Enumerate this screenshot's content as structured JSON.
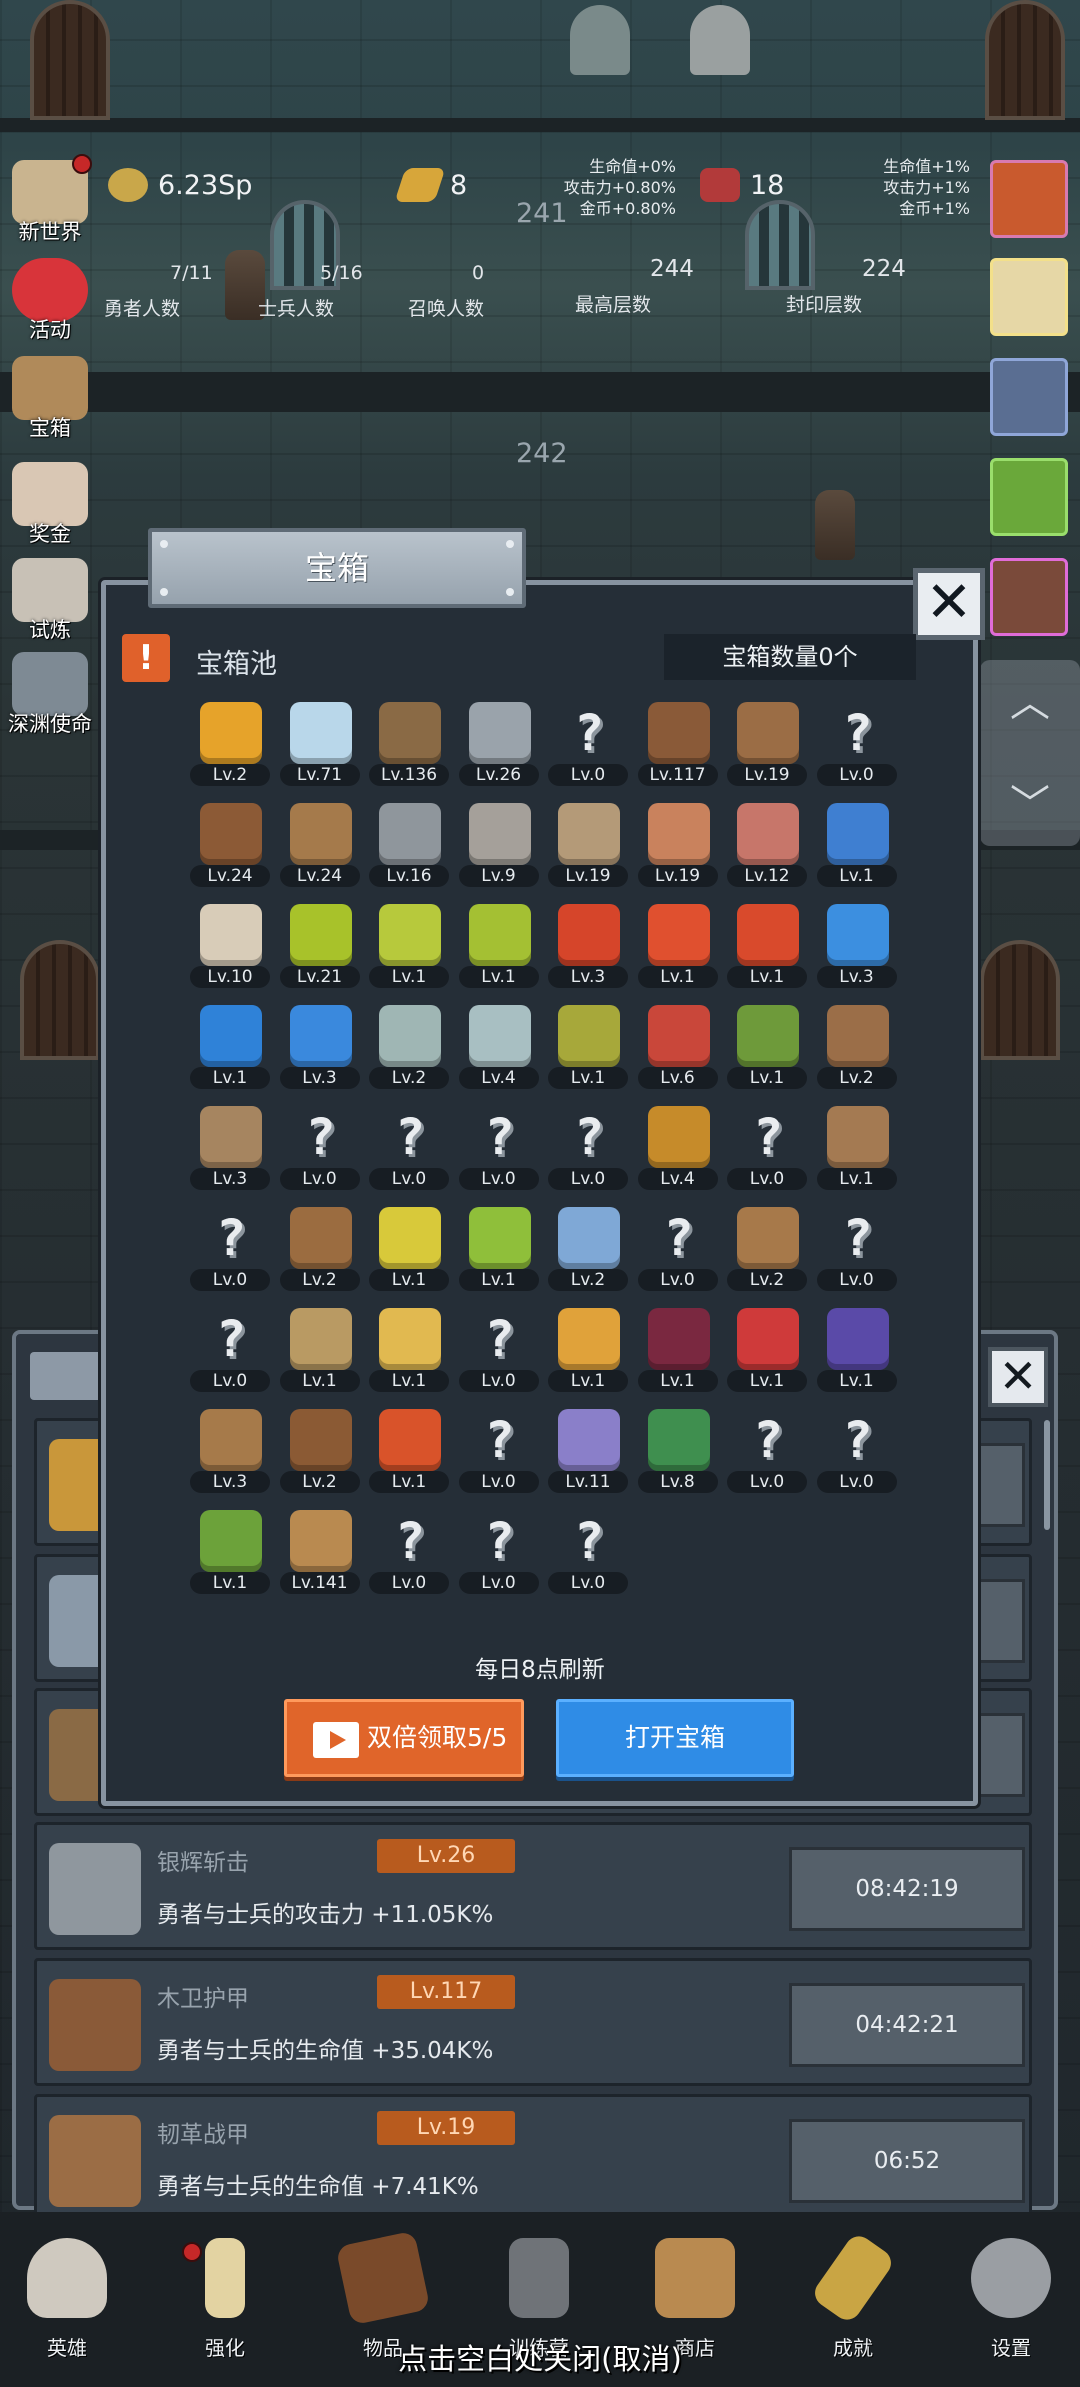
{
  "background": {
    "floor_number_top": "241",
    "floor_number_mid": "242"
  },
  "hud": {
    "coins": "6.23Sp",
    "gold_bars": "8",
    "meat": "18",
    "buff_left": [
      "生命值+0%",
      "攻击力+0.80%",
      "金币+0.80%"
    ],
    "buff_right": [
      "生命值+1%",
      "攻击力+1%",
      "金币+1%"
    ],
    "counts": [
      {
        "value": "7/11",
        "label": "勇者人数"
      },
      {
        "value": "5/16",
        "label": "士兵人数"
      },
      {
        "value": "0",
        "label": "召唤人数"
      },
      {
        "value": "244",
        "label": "最高层数"
      },
      {
        "value": "224",
        "label": "封印层数"
      }
    ]
  },
  "left_menu": [
    {
      "label": "新世界",
      "icon": "scroll-map-icon",
      "color": "#c9b48f",
      "dot": true
    },
    {
      "label": "活动",
      "icon": "heart-icon",
      "color": "#d8343a",
      "dot": false
    },
    {
      "label": "宝箱",
      "icon": "chest-icon",
      "color": "#b08a5a",
      "dot": false
    },
    {
      "label": "奖金",
      "icon": "envelope-icon",
      "color": "#d9c7b4",
      "dot": false
    },
    {
      "label": "试炼",
      "icon": "feather-icon",
      "color": "#c8c1b6",
      "dot": false
    },
    {
      "label": "深渊使命",
      "icon": "abyss-icon",
      "color": "#7e8a94",
      "dot": false
    }
  ],
  "dialog": {
    "title": "宝箱",
    "pool_title": "宝箱池",
    "chest_count": "宝箱数量0个",
    "refresh_note": "每日8点刷新",
    "double_claim": "双倍领取5/5",
    "open_chest": "打开宝箱"
  },
  "items": [
    {
      "icon": "crown-icon",
      "lv": "Lv.2",
      "color": "#e6a32a"
    },
    {
      "icon": "diamond-icon",
      "lv": "Lv.71",
      "color": "#b9d7ea"
    },
    {
      "icon": "sword-icon",
      "lv": "Lv.136",
      "color": "#8a6a45"
    },
    {
      "icon": "sword-icon",
      "lv": "Lv.26",
      "color": "#9aa3ab"
    },
    {
      "icon": "unknown-icon",
      "lv": "Lv.0",
      "color": ""
    },
    {
      "icon": "armor-icon",
      "lv": "Lv.117",
      "color": "#8a5a38"
    },
    {
      "icon": "leather-armor-icon",
      "lv": "Lv.19",
      "color": "#9b6d45"
    },
    {
      "icon": "unknown-icon",
      "lv": "Lv.0",
      "color": ""
    },
    {
      "icon": "leather-helmet-icon",
      "lv": "Lv.24",
      "color": "#8c5a36"
    },
    {
      "icon": "dagger-icon",
      "lv": "Lv.24",
      "color": "#a57a4b"
    },
    {
      "icon": "knight-helmet-icon",
      "lv": "Lv.16",
      "color": "#8f969c"
    },
    {
      "icon": "hammer-icon",
      "lv": "Lv.9",
      "color": "#a5a09a"
    },
    {
      "icon": "great-helm-icon",
      "lv": "Lv.19",
      "color": "#b49a78"
    },
    {
      "icon": "ham-icon",
      "lv": "Lv.19",
      "color": "#c9825d"
    },
    {
      "icon": "steak-icon",
      "lv": "Lv.12",
      "color": "#c7766a"
    },
    {
      "icon": "blue-sack-icon",
      "lv": "Lv.1",
      "color": "#3f7fd1"
    },
    {
      "icon": "flour-icon",
      "lv": "Lv.10",
      "color": "#d8ccb8"
    },
    {
      "icon": "green-potion-icon",
      "lv": "Lv.21",
      "color": "#a8c22a"
    },
    {
      "icon": "green-potion-icon",
      "lv": "Lv.1",
      "color": "#b7c93c"
    },
    {
      "icon": "green-potion-icon",
      "lv": "Lv.1",
      "color": "#a4c033"
    },
    {
      "icon": "red-potion-icon",
      "lv": "Lv.3",
      "color": "#d6452a"
    },
    {
      "icon": "red-potion-icon",
      "lv": "Lv.1",
      "color": "#e0502f"
    },
    {
      "icon": "red-potion-icon",
      "lv": "Lv.1",
      "color": "#d94a2c"
    },
    {
      "icon": "blue-potion-icon",
      "lv": "Lv.3",
      "color": "#3c8fe0"
    },
    {
      "icon": "blue-potion-icon",
      "lv": "Lv.1",
      "color": "#2f82d8"
    },
    {
      "icon": "blue-potion-icon",
      "lv": "Lv.3",
      "color": "#3a89dd"
    },
    {
      "icon": "vial-icon",
      "lv": "Lv.2",
      "color": "#9fb6b4"
    },
    {
      "icon": "vial-icon",
      "lv": "Lv.4",
      "color": "#a8bfc2"
    },
    {
      "icon": "yellow-bottle-icon",
      "lv": "Lv.1",
      "color": "#a7a83a"
    },
    {
      "icon": "red-bottle-icon",
      "lv": "Lv.6",
      "color": "#c9473a"
    },
    {
      "icon": "winged-boot-icon",
      "lv": "Lv.1",
      "color": "#6e9a3a"
    },
    {
      "icon": "boot-icon",
      "lv": "Lv.2",
      "color": "#9b6e48"
    },
    {
      "icon": "shoe-icon",
      "lv": "Lv.3",
      "color": "#a68560"
    },
    {
      "icon": "unknown-icon",
      "lv": "Lv.0",
      "color": ""
    },
    {
      "icon": "unknown-icon",
      "lv": "Lv.0",
      "color": ""
    },
    {
      "icon": "unknown-icon",
      "lv": "Lv.0",
      "color": ""
    },
    {
      "icon": "unknown-icon",
      "lv": "Lv.0",
      "color": ""
    },
    {
      "icon": "torch-icon",
      "lv": "Lv.4",
      "color": "#c68b2a"
    },
    {
      "icon": "unknown-icon",
      "lv": "Lv.0",
      "color": ""
    },
    {
      "icon": "mushroom-icon",
      "lv": "Lv.1",
      "color": "#a47a52"
    },
    {
      "icon": "unknown-icon",
      "lv": "Lv.0",
      "color": ""
    },
    {
      "icon": "staff-icon",
      "lv": "Lv.2",
      "color": "#9b6c40"
    },
    {
      "icon": "lemon-icon",
      "lv": "Lv.1",
      "color": "#d8c93a"
    },
    {
      "icon": "lime-icon",
      "lv": "Lv.1",
      "color": "#8fbf3a"
    },
    {
      "icon": "scepter-icon",
      "lv": "Lv.2",
      "color": "#7fa8d6"
    },
    {
      "icon": "unknown-icon",
      "lv": "Lv.0",
      "color": ""
    },
    {
      "icon": "backpack-icon",
      "lv": "Lv.2",
      "color": "#a7794a"
    },
    {
      "icon": "unknown-icon",
      "lv": "Lv.0",
      "color": ""
    },
    {
      "icon": "unknown-icon",
      "lv": "Lv.0",
      "color": ""
    },
    {
      "icon": "spiked-club-icon",
      "lv": "Lv.1",
      "color": "#b99a63"
    },
    {
      "icon": "cheese-icon",
      "lv": "Lv.1",
      "color": "#e1b950"
    },
    {
      "icon": "unknown-icon",
      "lv": "Lv.0",
      "color": ""
    },
    {
      "icon": "honey-jar-icon",
      "lv": "Lv.1",
      "color": "#e0a23a"
    },
    {
      "icon": "crystal-icon",
      "lv": "Lv.1",
      "color": "#7a2840"
    },
    {
      "icon": "red-orb-icon",
      "lv": "Lv.1",
      "color": "#cf3a3a"
    },
    {
      "icon": "magic-cube-icon",
      "lv": "Lv.1",
      "color": "#5a4aa8"
    },
    {
      "icon": "bow-icon",
      "lv": "Lv.3",
      "color": "#a67a4a"
    },
    {
      "icon": "quiver-icon",
      "lv": "Lv.2",
      "color": "#8b5a34"
    },
    {
      "icon": "flame-gauntlet-icon",
      "lv": "Lv.1",
      "color": "#d9532a"
    },
    {
      "icon": "unknown-icon",
      "lv": "Lv.0",
      "color": ""
    },
    {
      "icon": "rune-frame-icon",
      "lv": "Lv.11",
      "color": "#8a7fc9"
    },
    {
      "icon": "emblem-icon",
      "lv": "Lv.8",
      "color": "#3f8f4f"
    },
    {
      "icon": "unknown-icon",
      "lv": "Lv.0",
      "color": ""
    },
    {
      "icon": "unknown-icon",
      "lv": "Lv.0",
      "color": ""
    },
    {
      "icon": "green-wand-icon",
      "lv": "Lv.1",
      "color": "#6ca23a"
    },
    {
      "icon": "beer-mug-icon",
      "lv": "Lv.141",
      "color": "#b98a50"
    },
    {
      "icon": "unknown-icon",
      "lv": "Lv.0",
      "color": ""
    },
    {
      "icon": "unknown-icon",
      "lv": "Lv.0",
      "color": ""
    },
    {
      "icon": "unknown-icon",
      "lv": "Lv.0",
      "color": ""
    }
  ],
  "back_list": [
    {
      "name": "银辉斩击",
      "lv": "Lv.26",
      "desc": "勇者与士兵的攻击力 +11.05K%",
      "timer": "08:42:19",
      "icon": "sword-icon",
      "color": "#8f979e"
    },
    {
      "name": "木卫护甲",
      "lv": "Lv.117",
      "desc": "勇者与士兵的生命值 +35.04K%",
      "timer": "04:42:21",
      "icon": "armor-icon",
      "color": "#8a5a38"
    },
    {
      "name": "韧革战甲",
      "lv": "Lv.19",
      "desc": "勇者与士兵的生命值 +7.41K%",
      "timer": "06:52",
      "icon": "leather-armor-icon",
      "color": "#9b6d45"
    }
  ],
  "bottom_nav": [
    {
      "label": "英雄",
      "icon": "skull-icon",
      "color": "#cfc9bf",
      "dot": false
    },
    {
      "label": "强化",
      "icon": "candle-icon",
      "color": "#e3d3a2",
      "dot": true
    },
    {
      "label": "物品",
      "icon": "book-icon",
      "color": "#7a4a2a",
      "dot": false
    },
    {
      "label": "训练营",
      "icon": "lantern-icon",
      "color": "#6f7378",
      "dot": false
    },
    {
      "label": "商店",
      "icon": "mug-icon",
      "color": "#b98a50",
      "dot": false
    },
    {
      "label": "成就",
      "icon": "key-icon",
      "color": "#c9a544",
      "dot": false
    },
    {
      "label": "设置",
      "icon": "gear-icon",
      "color": "#9a9ea3",
      "dot": false
    }
  ],
  "close_hint": "点击空白处关闭(取消)"
}
